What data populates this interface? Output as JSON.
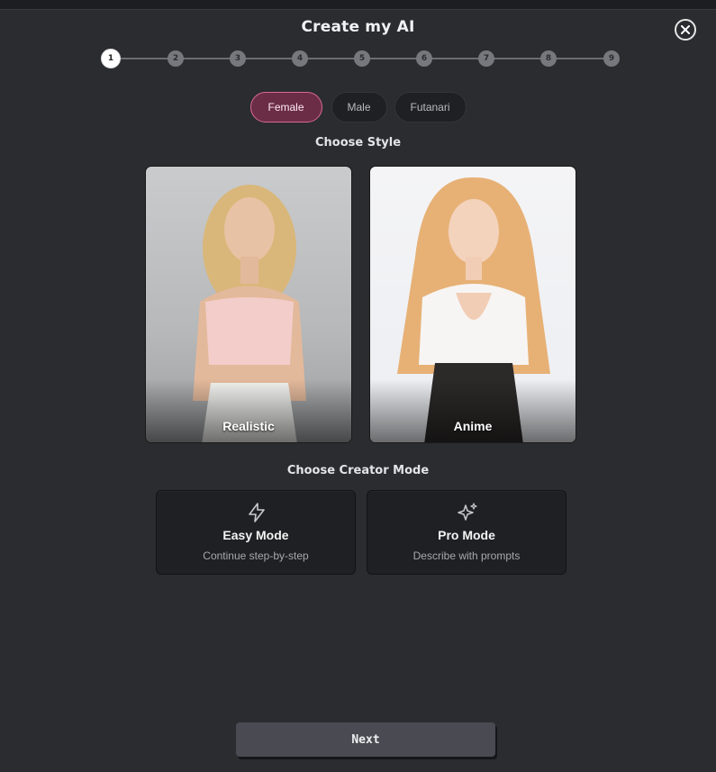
{
  "dialog": {
    "title": "Create my AI"
  },
  "stepper": {
    "steps": [
      "1",
      "2",
      "3",
      "4",
      "5",
      "6",
      "7",
      "8",
      "9"
    ],
    "active_step": 1
  },
  "gender_tabs": {
    "female": "Female",
    "male": "Male",
    "futanari": "Futanari",
    "selected": "Female"
  },
  "style_section": {
    "label": "Choose Style",
    "options": {
      "realistic": "Realistic",
      "anime": "Anime"
    }
  },
  "mode_section": {
    "label": "Choose Creator Mode",
    "easy": {
      "title": "Easy Mode",
      "subtitle": "Continue step-by-step",
      "icon": "lightning-icon"
    },
    "pro": {
      "title": "Pro Mode",
      "subtitle": "Describe with prompts",
      "icon": "sparkles-icon"
    }
  },
  "footer": {
    "next_label": "Next"
  },
  "colors": {
    "background": "#2b2c30",
    "accent_pill": "#6b2d46",
    "accent_border": "#d96a8e",
    "card": "#1f2024",
    "button": "#4a4b52"
  }
}
